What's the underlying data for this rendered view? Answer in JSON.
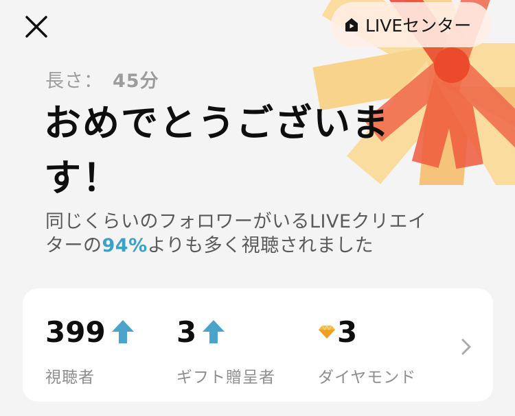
{
  "header": {
    "live_center_label": "LIVEセンター"
  },
  "summary": {
    "duration_label": "長さ：",
    "duration_value": "45分",
    "title_line1": "おめでとうございま",
    "title_line2": "す！",
    "subtitle_part1": "同じくらいのフォロワーがいるLIVEクリエイ",
    "subtitle_part2": "ターの",
    "subtitle_percent": "94%",
    "subtitle_part3": "よりも多く視聴されました"
  },
  "stats": [
    {
      "value": "399",
      "label": "視聴者",
      "icon": "up-arrow-icon"
    },
    {
      "value": "3",
      "label": "ギフト贈呈者",
      "icon": "up-arrow-icon"
    },
    {
      "value": "3",
      "label": "ダイヤモンド",
      "icon": "diamond-icon"
    }
  ],
  "colors": {
    "accent_blue": "#3ba1c6",
    "arrow_blue": "#4aa3c9",
    "burst_red": "#ef5b3c",
    "burst_orange": "#f7a348",
    "burst_yellow": "#fbd582"
  }
}
